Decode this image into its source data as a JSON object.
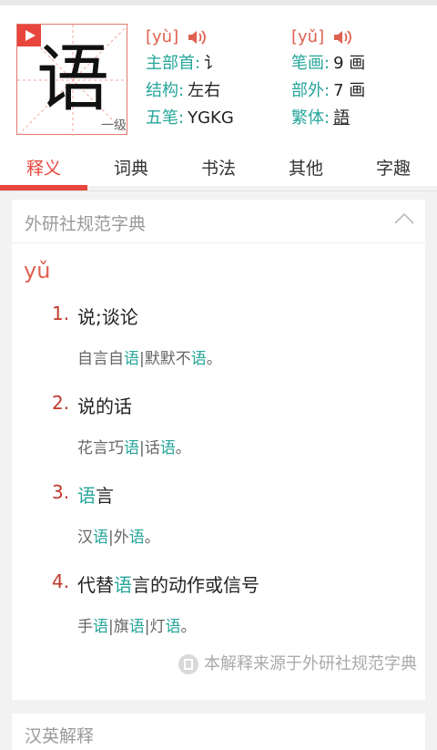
{
  "character": {
    "glyph": "语",
    "level": "一级"
  },
  "info": {
    "pinyin_left": "[yù]",
    "pinyin_right": "[yǔ]",
    "radical_label": "主部首:",
    "radical_value": "讠",
    "strokes_label": "笔画:",
    "strokes_value": "9 画",
    "structure_label": "结构:",
    "structure_value": "左右",
    "outer_label": "部外:",
    "outer_value": "7 画",
    "wubi_label": "五笔:",
    "wubi_value": "YGKG",
    "traditional_label": "繁体:",
    "traditional_value": "語"
  },
  "tabs": [
    "释义",
    "词典",
    "书法",
    "其他",
    "字趣"
  ],
  "active_tab": "释义",
  "card": {
    "title": "外研社规范字典",
    "pinyin": "yǔ",
    "source": "本解释来源于外研社规范字典"
  },
  "definitions": [
    {
      "num": "1.",
      "text": "说;谈论",
      "example": [
        {
          "t": "自言自"
        },
        {
          "t": "语",
          "h": true
        },
        {
          "t": "|默默不"
        },
        {
          "t": "语",
          "h": true
        },
        {
          "t": "。"
        }
      ]
    },
    {
      "num": "2.",
      "text": "说的话",
      "example": [
        {
          "t": "花言巧"
        },
        {
          "t": "语",
          "h": true
        },
        {
          "t": "|话"
        },
        {
          "t": "语",
          "h": true
        },
        {
          "t": "。"
        }
      ]
    },
    {
      "num": "3.",
      "text_parts": [
        {
          "t": "语",
          "h": true
        },
        {
          "t": "言"
        }
      ],
      "example": [
        {
          "t": "汉"
        },
        {
          "t": "语",
          "h": true
        },
        {
          "t": "|外"
        },
        {
          "t": "语",
          "h": true
        },
        {
          "t": "。"
        }
      ]
    },
    {
      "num": "4.",
      "text_parts": [
        {
          "t": "代替"
        },
        {
          "t": "语",
          "h": true
        },
        {
          "t": "言的动作或信号"
        }
      ],
      "example": [
        {
          "t": "手"
        },
        {
          "t": "语",
          "h": true
        },
        {
          "t": "|旗"
        },
        {
          "t": "语",
          "h": true
        },
        {
          "t": "|灯"
        },
        {
          "t": "语",
          "h": true
        },
        {
          "t": "。"
        }
      ]
    }
  ],
  "second_card_title": "汉英解释",
  "colors": {
    "accent": "#e8453c",
    "teal": "#26a69a",
    "link": "#2f80c8"
  }
}
